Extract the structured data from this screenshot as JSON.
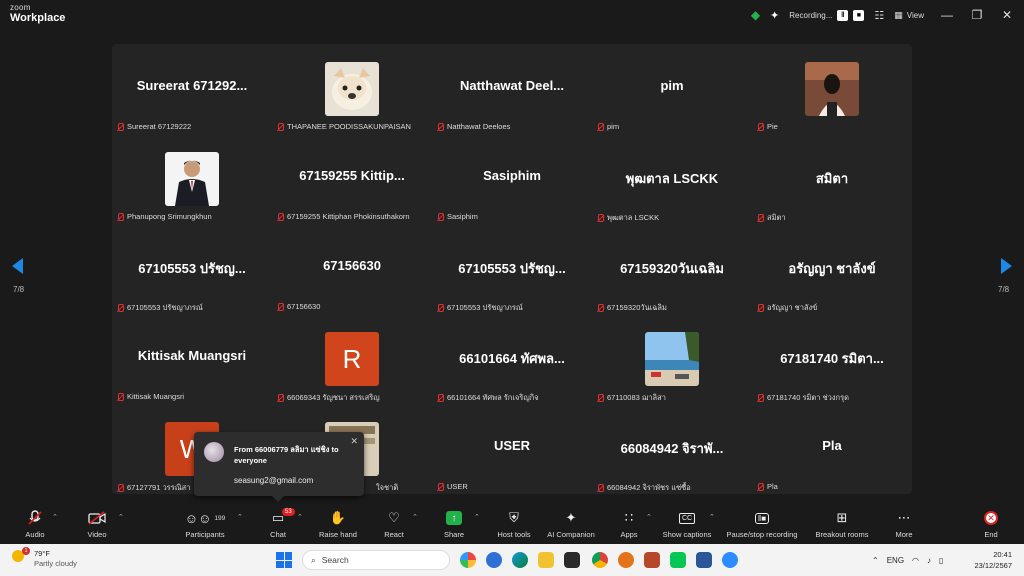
{
  "app": {
    "brand_top": "zoom",
    "brand_bottom": "Workplace"
  },
  "titlebar": {
    "recording_label": "Recording...",
    "view_label": "View"
  },
  "gallery": {
    "page_indicator": "7/8",
    "tiles": [
      {
        "center": "Sureerat  671292...",
        "label": "Sureerat 67129222"
      },
      {
        "center": "",
        "label": "THAPANEE POODISSAKUNPAISAN"
      },
      {
        "center": "Natthawat  Deel...",
        "label": "Natthawat Deeloes"
      },
      {
        "center": "pim",
        "label": "pim"
      },
      {
        "center": "",
        "label": "Pie"
      },
      {
        "center": "",
        "label": "Phanupong Srimungkhun"
      },
      {
        "center": "67159255  Kittip...",
        "label": "67159255 Kittiphan Phokinsuthakorn"
      },
      {
        "center": "Sasiphim",
        "label": "Sasiphim"
      },
      {
        "center": "พุฒตาล LSCKK",
        "label": "พุฒตาล LSCKK"
      },
      {
        "center": "สมิตา",
        "label": "สมิตา"
      },
      {
        "center": "67105553 ปรัชญ...",
        "label": "67105553 ปรัชญาภรณ์"
      },
      {
        "center": "67156630",
        "label": "67156630"
      },
      {
        "center": "67105553 ปรัชญ...",
        "label": "67105553 ปรัชญาภรณ์"
      },
      {
        "center": "67159320วันเฉลิม",
        "label": "67159320วันเฉลิม"
      },
      {
        "center": "อรัญญา ชาลังข์",
        "label": "อรัญญา ชาลังข์"
      },
      {
        "center": "Kittisak Muangsri",
        "label": "Kittisak Muangsri"
      },
      {
        "center": "R",
        "label": "66069343 รัญชนา สรรเสริญ"
      },
      {
        "center": "66101664 ทัศพล...",
        "label": "66101664 ทัศพล รักเจริญกิจ"
      },
      {
        "center": "",
        "label": "67110083 ฌาลิสา"
      },
      {
        "center": "67181740 รมิตา...",
        "label": "67181740 รมิตา ช่วงกรุด"
      },
      {
        "center": "W",
        "label": "67127791 วรรณิสา"
      },
      {
        "center": "",
        "label": "ใจชาติ"
      },
      {
        "center": "USER",
        "label": "USER"
      },
      {
        "center": "66084942 จิราพั...",
        "label": "66084942 จิราพัชร แซ่ซื้อ"
      },
      {
        "center": "Pla",
        "label": "Pla"
      }
    ]
  },
  "chat_popup": {
    "from": "From  66006779 ลลิมา แซ่ชิง  to  everyone",
    "message": "seasung2@gmail.com"
  },
  "toolbar": {
    "audio": "Audio",
    "video": "Video",
    "participants": "Participants",
    "participants_count": "199",
    "chat": "Chat",
    "chat_badge": "53",
    "raise_hand": "Raise hand",
    "react": "React",
    "share": "Share",
    "host_tools": "Host tools",
    "ai_companion": "AI Companion",
    "apps": "Apps",
    "show_captions": "Show captions",
    "captions_icon_text": "CC",
    "pause_stop_recording": "Pause/stop recording",
    "breakout_rooms": "Breakout rooms",
    "more": "More",
    "end": "End"
  },
  "taskbar": {
    "temperature": "79°F",
    "weather_condition": "Partly cloudy",
    "weather_badge": "1",
    "search_placeholder": "Search",
    "language": "ENG",
    "time": "20:41",
    "date": "23/12/2567"
  }
}
